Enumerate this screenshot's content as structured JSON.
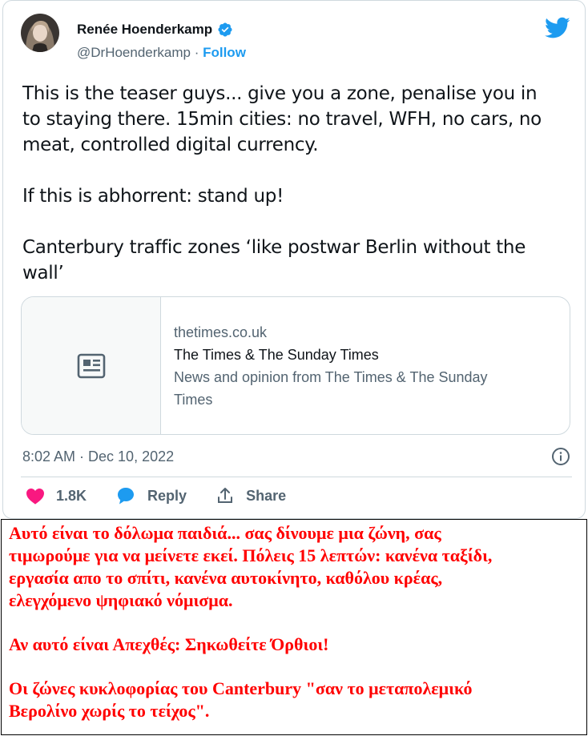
{
  "tweet": {
    "author_name": "Renée Hoenderkamp",
    "handle": "@DrHoenderkamp",
    "separator": " · ",
    "follow_label": "Follow",
    "body": {
      "p1_line1": "This is the teaser guys... give you a zone, penalise you in",
      "p1_line2": "to staying there. 15min cities: no travel, WFH, no cars, no",
      "p1_line3": "meat, controlled digital currency.",
      "p2": "If this is abhorrent: stand up!",
      "p3_line1": "Canterbury traffic zones ‘like postwar Berlin without the",
      "p3_line2": "wall’"
    },
    "card": {
      "domain": "thetimes.co.uk",
      "title": "The Times & The Sunday Times",
      "desc_line1": "News and opinion from The Times & The Sunday",
      "desc_line2": "Times"
    },
    "timestamp": "8:02 AM · Dec 10, 2022",
    "actions": {
      "likes": "1.8K",
      "reply": "Reply",
      "share": "Share"
    },
    "colors": {
      "accent": "#1d9bf0",
      "like": "#f91880",
      "muted": "#536471"
    },
    "icons": [
      "twitter-bird-icon",
      "verified-badge-icon",
      "article-icon",
      "info-icon",
      "heart-icon",
      "reply-bubble-icon",
      "share-icon"
    ]
  },
  "translation": {
    "color": "#ff0000",
    "p1_line1": "Αυτό είναι το δόλωμα παιδιά... σας δίνουμε μια ζώνη, σας",
    "p1_line2": "τιμωρούμε για να μείνετε εκεί. Πόλεις 15 λεπτών: κανένα ταξίδι,",
    "p1_line3": "εργασία απο το σπίτι, κανένα αυτοκίνητο, καθόλου κρέας,",
    "p1_line4": "ελεγχόμενο ψηφιακό νόμισμα.",
    "p2": "Αν αυτό είναι Απεχθές: Σηκωθείτε Όρθιοι!",
    "p3_line1": "Οι ζώνες κυκλοφορίας του Canterbury \"σαν το μεταπολεμικό",
    "p3_line2": "Βερολίνο χωρίς το τείχος\"."
  }
}
